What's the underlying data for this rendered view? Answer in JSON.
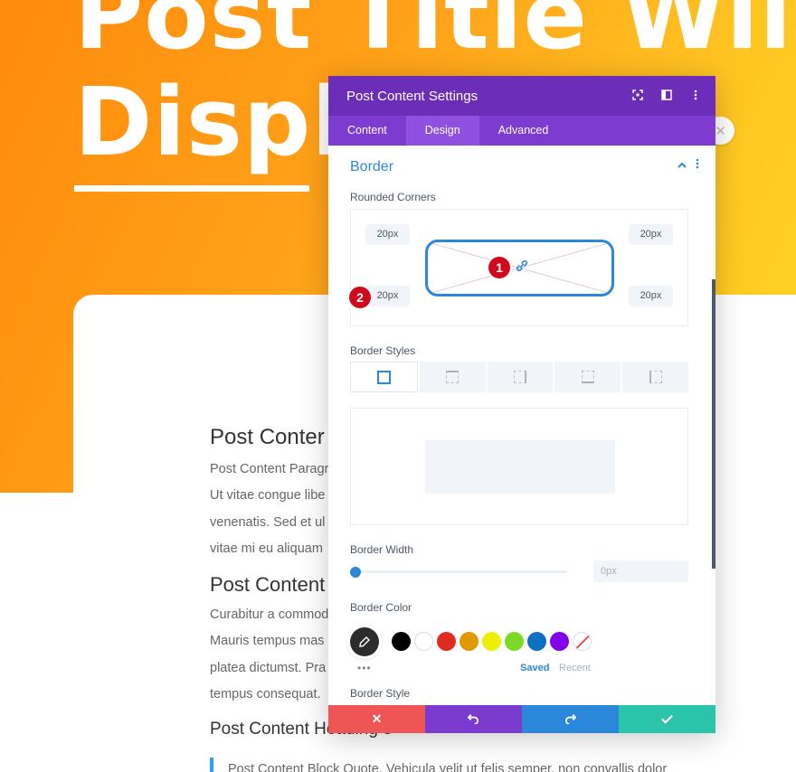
{
  "page": {
    "hero_title_line1": "Post Title Will",
    "hero_title_line2": "Displ",
    "article": {
      "heading1": "Post Conter",
      "para1_line1": "Post Content Paragr",
      "para1_line2": "Ut vitae congue libe",
      "para1_line3": "venenatis. Sed et ul",
      "para1_line4": "vitae mi eu aliquam",
      "heading2": "Post Content",
      "para2_line1": "Curabitur a commod",
      "para2_line2": "Mauris tempus mas",
      "para2_line3": "platea dictumst. Pra",
      "para2_line4": "tempus consequat.",
      "heading3": "Post Content Heading 3",
      "quote": "Post Content Block Quote. Vehicula velit ut felis semper, non convallis dolor"
    }
  },
  "modal": {
    "title": "Post Content Settings",
    "header_icons": [
      "fullscreen-icon",
      "sidebar-layout-icon",
      "more-vertical-icon"
    ],
    "tabs": [
      {
        "label": "Content",
        "active": false
      },
      {
        "label": "Design",
        "active": true
      },
      {
        "label": "Advanced",
        "active": false
      }
    ],
    "section": {
      "title": "Border",
      "rounded_corners_label": "Rounded Corners",
      "corners": {
        "top_left": "20px",
        "top_right": "20px",
        "bottom_left": "20px",
        "bottom_right": "20px"
      },
      "badges": [
        "1",
        "2"
      ],
      "border_styles_label": "Border Styles",
      "border_style_options": [
        "all",
        "top",
        "right",
        "bottom",
        "left"
      ],
      "border_width_label": "Border Width",
      "border_width_value": "",
      "border_width_placeholder": "0px",
      "border_width_slider": 0,
      "border_color_label": "Border Color",
      "swatches": [
        "#000000",
        "#ffffff",
        "#e02b20",
        "#e09900",
        "#edf000",
        "#7cda24",
        "#0c71c3",
        "#8300e9"
      ],
      "color_more": "•••",
      "saved_label": "Saved",
      "recent_label": "Recent",
      "border_style_label": "Border Style"
    },
    "footer": {
      "cancel_icon": "close-icon",
      "undo_icon": "undo-icon",
      "redo_icon": "redo-icon",
      "save_icon": "check-icon"
    },
    "colors": {
      "header": "#6c2eb9",
      "tabs": "#7d3bcf",
      "accent": "#2b87da",
      "cancel": "#ef5555",
      "undo": "#7c3bcf",
      "redo": "#2b87da",
      "save": "#29c4a9",
      "badge": "#d00a1c"
    }
  }
}
